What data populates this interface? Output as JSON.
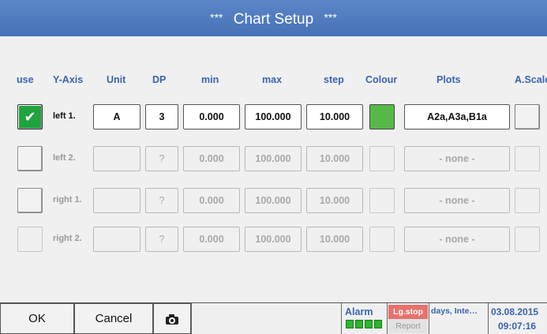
{
  "title": {
    "stars_left": "***",
    "text": "Chart Setup",
    "stars_right": "***"
  },
  "headers": {
    "use": "use",
    "yaxis": "Y-Axis",
    "unit": "Unit",
    "dp": "DP",
    "min": "min",
    "max": "max",
    "step": "step",
    "colour": "Colour",
    "plots": "Plots",
    "ascale": "A.Scale"
  },
  "rows": [
    {
      "label": "left 1.",
      "enabled": true,
      "checked": true,
      "unit": "A",
      "dp": "3",
      "min": "0.000",
      "max": "100.000",
      "step": "10.000",
      "colour": "#56b947",
      "plots": "A2a,A3a,B1a"
    },
    {
      "label": "left 2.",
      "enabled": false,
      "checked": false,
      "unit": "",
      "dp": "?",
      "min": "0.000",
      "max": "100.000",
      "step": "10.000",
      "colour": "",
      "plots": "- none -"
    },
    {
      "label": "right 1.",
      "enabled": false,
      "checked": false,
      "unit": "",
      "dp": "?",
      "min": "0.000",
      "max": "100.000",
      "step": "10.000",
      "colour": "",
      "plots": "- none -"
    },
    {
      "label": "right 2.",
      "enabled": false,
      "checked": false,
      "unit": "",
      "dp": "?",
      "min": "0.000",
      "max": "100.000",
      "step": "10.000",
      "colour": "",
      "plots": "- none -"
    }
  ],
  "bottom": {
    "ok": "OK",
    "cancel": "Cancel",
    "camera_icon": "camera-icon",
    "alarm": "Alarm",
    "lgstop": "Lg.stop",
    "report": "Report",
    "days": "days, Inte…",
    "date": "03.08.2015",
    "time": "09:07:16"
  },
  "colors": {
    "title_bg": "#4a76bb",
    "header_text": "#3a64b0",
    "check_green": "#1fa33e",
    "lgstop_bg": "#e8716d",
    "alarm_led": "#2bb52b"
  }
}
